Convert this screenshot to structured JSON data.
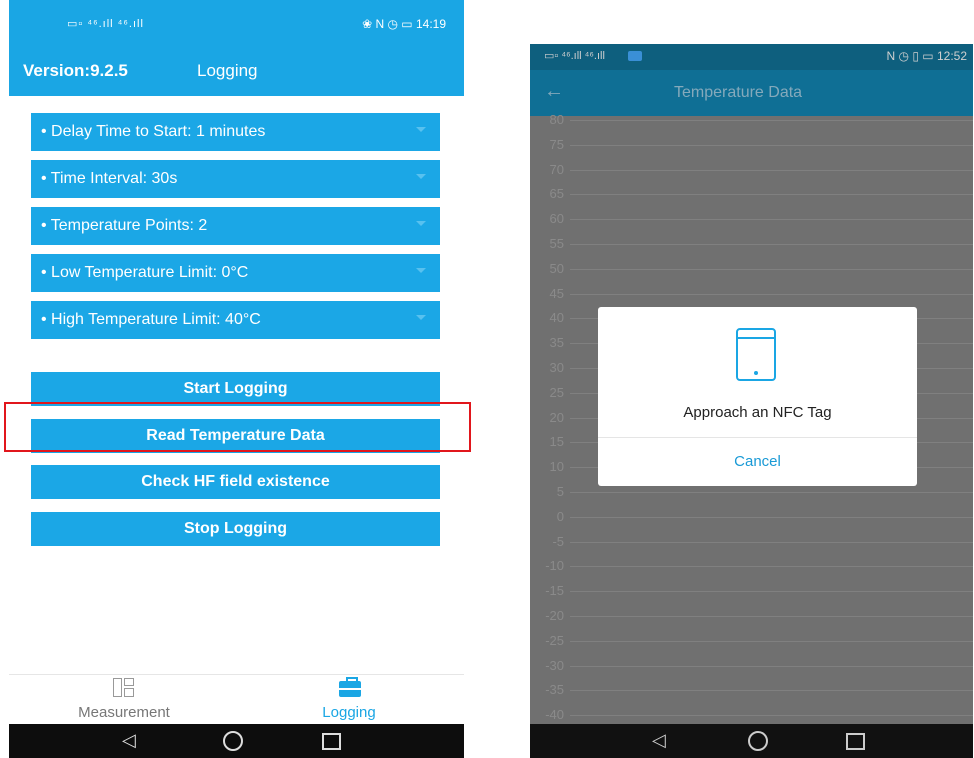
{
  "left_phone": {
    "status": {
      "signal": "▭▫ ⁴⁶.ıll ⁴⁶.ıll",
      "time": "14:19",
      "icons": "❀ N ◷ ▭"
    },
    "header": {
      "version": "Version:9.2.5",
      "title": "Logging"
    },
    "settings": [
      {
        "label": "• Delay Time to Start:  1 minutes"
      },
      {
        "label": "• Time Interval:  30s"
      },
      {
        "label": "• Temperature Points:  2"
      },
      {
        "label": "• Low Temperature Limit:  0°C"
      },
      {
        "label": "• High Temperature Limit:  40°C"
      }
    ],
    "buttons": {
      "start": "Start Logging",
      "read": "Read Temperature Data",
      "check": "Check HF field existence",
      "stop": "Stop Logging"
    },
    "tabs": {
      "measurement": "Measurement",
      "logging": "Logging"
    },
    "nav": {
      "back": "◁"
    }
  },
  "right_phone": {
    "status": {
      "signal": "▭▫ ⁴⁶.ıll ⁴⁶.ıll",
      "time": "12:52",
      "icons": "N ◷ ▯ ▭"
    },
    "header": {
      "back": "←",
      "title": "Temperature Data"
    },
    "y_ticks": [
      "80",
      "75",
      "70",
      "65",
      "60",
      "55",
      "50",
      "45",
      "40",
      "35",
      "30",
      "25",
      "20",
      "15",
      "10",
      "5",
      "0",
      "-5",
      "-10",
      "-15",
      "-20",
      "-25",
      "-30",
      "-35",
      "-40"
    ],
    "dialog": {
      "message": "Approach an NFC Tag",
      "cancel": "Cancel"
    },
    "nav": {
      "back": "◁"
    }
  },
  "colors": {
    "accent": "#1aa6e4",
    "highlight": "#e1161c",
    "dark_header": "#0f6f95"
  }
}
